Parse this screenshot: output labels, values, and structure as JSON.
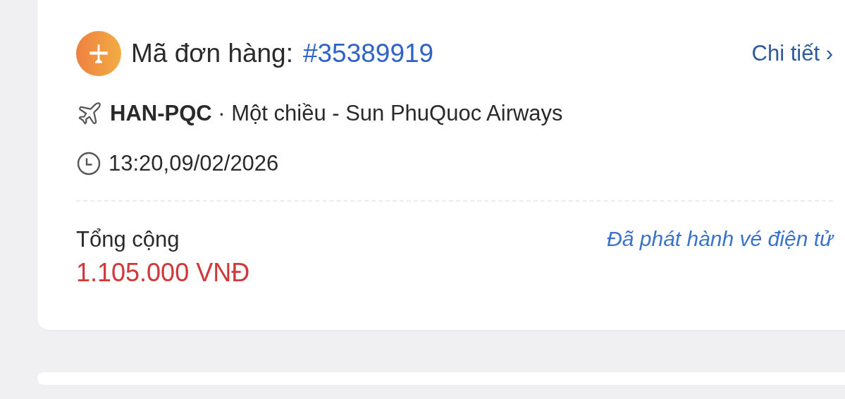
{
  "order": {
    "label": "Mã đơn hàng:",
    "number": "#35389919",
    "detail_link": "Chi tiết ›"
  },
  "route": "**HAN-PQC** · Một chiều - Sun PhuQuoc Airways",
  "time": "13:20,09/02/2026",
  "total": {
    "label": "Tổng cộng",
    "amount": "1.105.000 VNĐ"
  },
  "status": "Đã phát hành vé điện tử"
}
